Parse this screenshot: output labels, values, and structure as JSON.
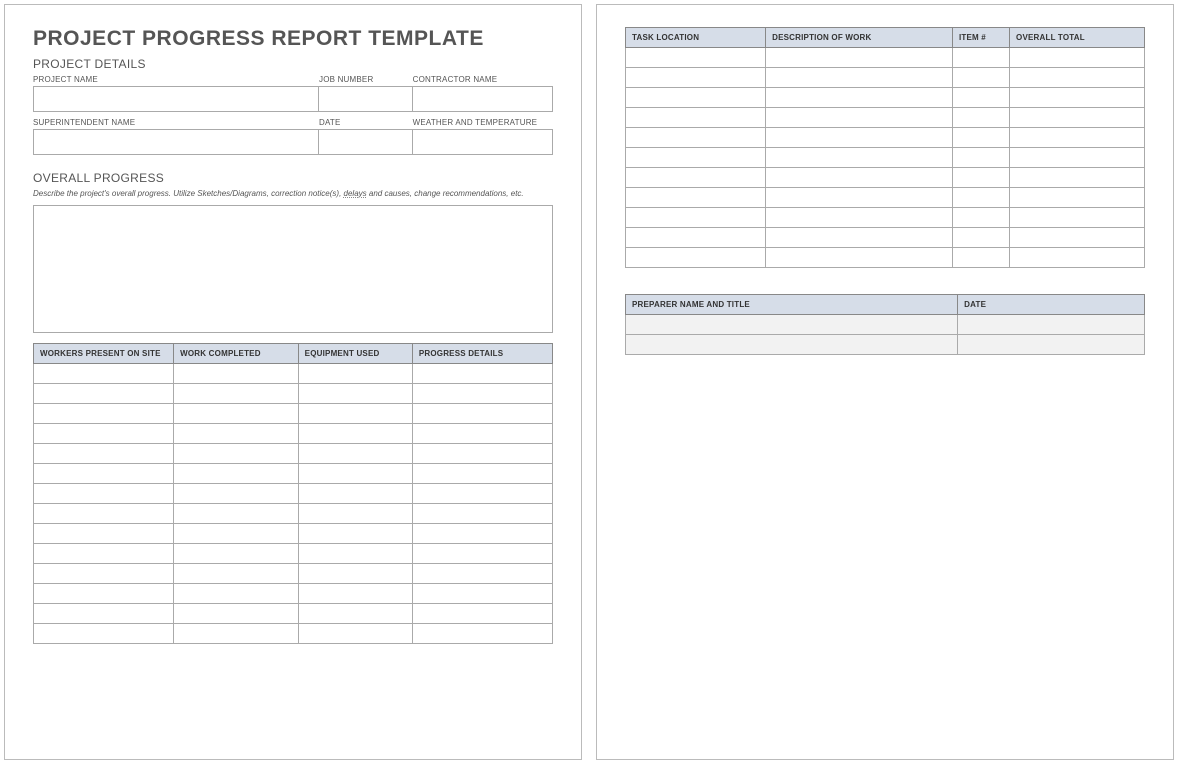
{
  "title": "PROJECT PROGRESS REPORT TEMPLATE",
  "sections": {
    "project_details": "PROJECT DETAILS",
    "overall_progress": "OVERALL PROGRESS"
  },
  "fields": {
    "project_name": "PROJECT NAME",
    "job_number": "JOB NUMBER",
    "contractor_name": "CONTRACTOR NAME",
    "superintendent_name": "SUPERINTENDENT NAME",
    "date": "DATE",
    "weather_temp": "WEATHER AND TEMPERATURE"
  },
  "instructions": {
    "part1": "Describe the project's overall progress. Utilize Sketches/Diagrams, correction notice(s), ",
    "word_delays": "delays",
    "part2": " and causes, change recommendations, etc."
  },
  "table1": {
    "headers": [
      "WORKERS PRESENT ON SITE",
      "WORK COMPLETED",
      "EQUIPMENT USED",
      "PROGRESS DETAILS"
    ],
    "row_count": 14
  },
  "table2": {
    "headers": [
      "TASK LOCATION",
      "DESCRIPTION OF WORK",
      "ITEM #",
      "OVERALL TOTAL"
    ],
    "row_count": 11
  },
  "table3": {
    "headers": [
      "PREPARER NAME AND TITLE",
      "DATE"
    ],
    "row_count": 2
  }
}
